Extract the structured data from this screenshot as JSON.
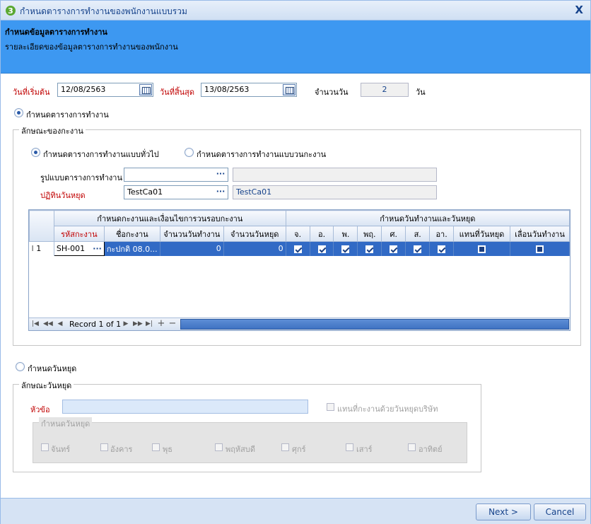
{
  "window": {
    "title": "กำหนดตารางการทำงานของพนักงานแบบรวม",
    "close_label": "X"
  },
  "header": {
    "title": "กำหนดข้อมูลตารางการทำงาน",
    "subtitle": "รายละเอียดของข้อมูลตารางการทำงานของพนักงาน"
  },
  "dates": {
    "start_label": "วันที่เริ่มต้น",
    "start_value": "12/08/2563",
    "end_label": "วันที่สิ้นสุด",
    "end_value": "13/08/2563",
    "days_label": "จำนวนวัน",
    "days_value": "2",
    "days_unit": "วัน"
  },
  "schedule": {
    "radio_label": "กำหนดตารางการทำงาน",
    "group_label": "ลักษณะของกะงาน",
    "option_general": "กำหนดตารางการทำงานแบบทั่วไป",
    "option_rotating": "กำหนดตารางการทำงานแบบวนกะงาน",
    "pattern_label": "รูปแบบตารางการทำงาน",
    "pattern_value": "",
    "pattern_desc": "",
    "calendar_label": "ปฏิทินวันหยุด",
    "calendar_value": "TestCa01",
    "calendar_desc": "TestCa01"
  },
  "grid": {
    "group_shift": "กำหนดกะงานและเงื่อนไขการวนรอบกะงาน",
    "group_days": "กำหนดวันทำงานและวันหยุด",
    "columns": [
      "รหัสกะงาน",
      "ชื่อกะงาน",
      "จำนวนวันทำงาน",
      "จำนวนวันหยุด",
      "จ.",
      "อ.",
      "พ.",
      "พฤ.",
      "ศ.",
      "ส.",
      "อา.",
      "แทนที่วันหยุด",
      "เลื่อนวันทำงาน"
    ],
    "rows": [
      {
        "index": "1",
        "code": "SH-001",
        "name": "กะปกติ 08.0...",
        "work_days": "0",
        "off_days": "0"
      }
    ],
    "record_text": "Record 1 of 1"
  },
  "holiday": {
    "radio_label": "กำหนดวันหยุด",
    "group_label": "ลักษณะวันหยุด",
    "topic_label": "หัวข้อ",
    "topic_value": "",
    "replace_label": "แทนที่กะงานด้วยวันหยุดบริษัท",
    "days_group_label": "กำหนดวันหยุด",
    "days": [
      "จันทร์",
      "อังคาร",
      "พุธ",
      "พฤหัสบดี",
      "ศุกร์",
      "เสาร์",
      "อาทิตย์"
    ]
  },
  "footer": {
    "next_label": "Next >",
    "cancel_label": "Cancel"
  }
}
